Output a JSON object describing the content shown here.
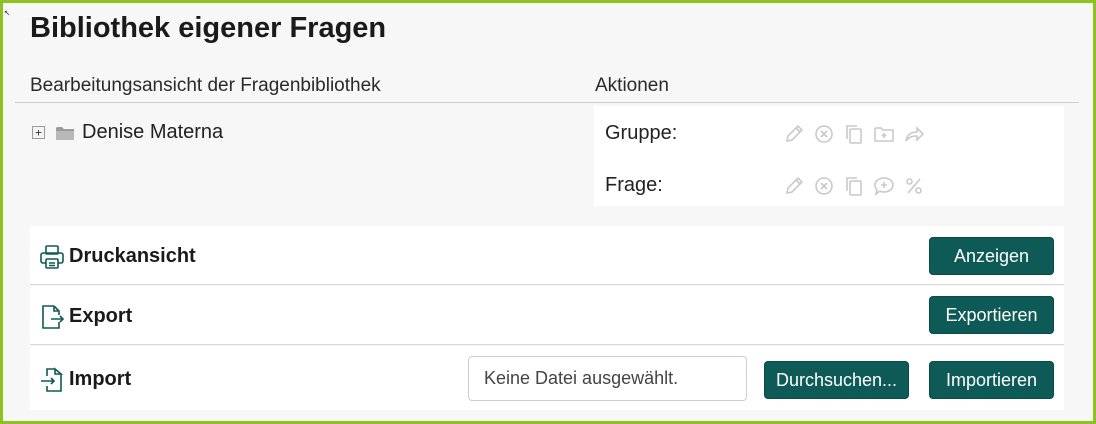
{
  "page": {
    "title": "Bibliothek eigener Fragen"
  },
  "library": {
    "view_header": "Bearbeitungsansicht der Fragenbibliothek",
    "actions_header": "Aktionen",
    "tree": {
      "expander": "+",
      "root_label": "Denise Materna"
    }
  },
  "actions": {
    "group_label": "Gruppe:",
    "question_label": "Frage:",
    "group_icons": [
      "pencil-icon",
      "delete-circle-icon",
      "copy-icon",
      "add-folder-icon",
      "share-arrow-icon"
    ],
    "question_icons": [
      "pencil-icon",
      "delete-circle-icon",
      "copy-icon",
      "add-comment-icon",
      "percent-icon"
    ]
  },
  "print_section": {
    "title": "Druckansicht",
    "button": "Anzeigen"
  },
  "export_section": {
    "title": "Export",
    "button": "Exportieren"
  },
  "import_section": {
    "title": "Import",
    "file_placeholder": "Keine Datei ausgewählt.",
    "browse_button": "Durchsuchen...",
    "import_button": "Importieren"
  },
  "colors": {
    "frame_border": "#8dc21f",
    "button_bg": "#0e5a57",
    "icon_disabled": "#c9c9c9"
  }
}
